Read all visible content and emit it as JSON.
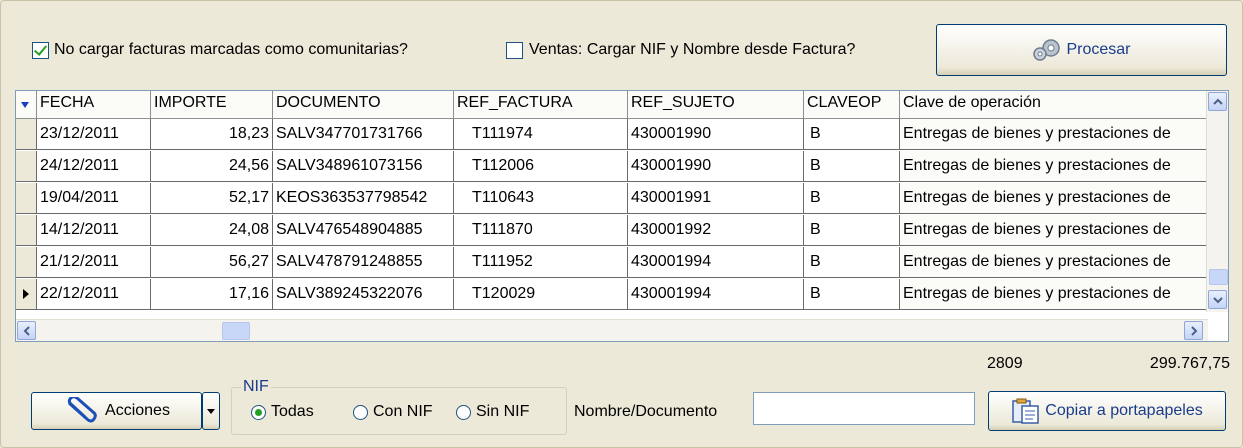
{
  "top_bar": {
    "check_comunitarias_label": "No cargar facturas marcadas como comunitarias?",
    "check_comunitarias_checked": true,
    "check_ventas_label": "Ventas: Cargar NIF y Nombre desde Factura?",
    "check_ventas_checked": false,
    "process_button_label": "Procesar",
    "process_icon": "gears-icon"
  },
  "grid": {
    "columns": [
      "FECHA",
      "IMPORTE",
      "DOCUMENTO",
      "REF_FACTURA",
      "REF_SUJETO",
      "CLAVEOP",
      "Clave de operación"
    ],
    "rows": [
      [
        "23/12/2011",
        "18,23",
        "SALV347701731766",
        "T111974",
        "430001990",
        "B",
        "Entregas de bienes y prestaciones de"
      ],
      [
        "24/12/2011",
        "24,56",
        "SALV348961073156",
        "T112006",
        "430001990",
        "B",
        "Entregas de bienes y prestaciones de"
      ],
      [
        "19/04/2011",
        "52,17",
        "KEOS363537798542",
        "T110643",
        "430001991",
        "B",
        "Entregas de bienes y prestaciones de"
      ],
      [
        "14/12/2011",
        "24,08",
        "SALV476548904885",
        "T111870",
        "430001992",
        "B",
        "Entregas de bienes y prestaciones de"
      ],
      [
        "21/12/2011",
        "56,27",
        "SALV478791248855",
        "T111952",
        "430001994",
        "B",
        "Entregas de bienes y prestaciones de"
      ],
      [
        "22/12/2011",
        "17,16",
        "SALV389245322076",
        "T120029",
        "430001994",
        "B",
        "Entregas de bienes y prestaciones de"
      ]
    ],
    "current_row_index": 5
  },
  "totals": {
    "count": "2809",
    "amount": "299.767,75"
  },
  "bottom_bar": {
    "actions_button_label": "Acciones",
    "actions_icon": "paperclip-icon",
    "nif_group_label": "NIF",
    "radio_all_label": "Todas",
    "radio_with_nif_label": "Con NIF",
    "radio_without_nif_label": "Sin NIF",
    "selected_radio": "Todas",
    "search_label": "Nombre/Documento",
    "search_value": "",
    "copy_button_label": "Copiar a portapapeles",
    "copy_icon": "clipboard-icon"
  }
}
